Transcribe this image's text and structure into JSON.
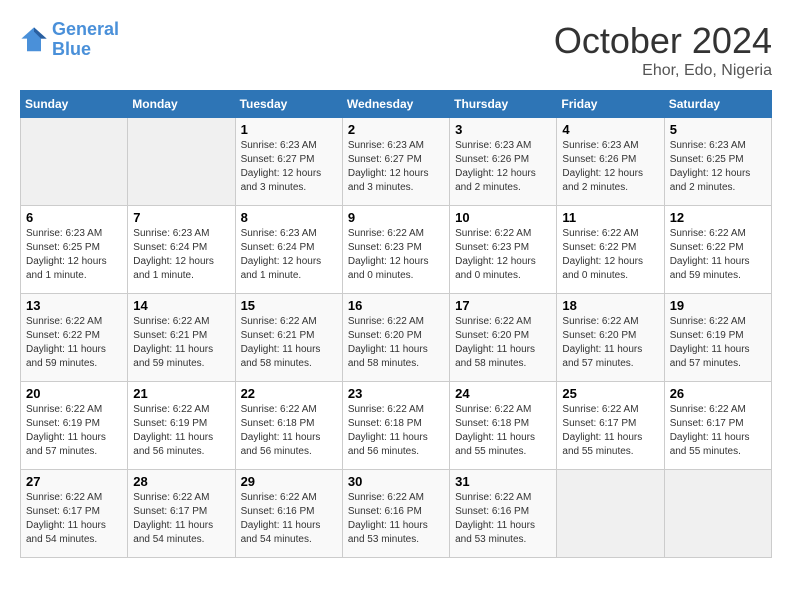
{
  "header": {
    "logo_line1": "General",
    "logo_line2": "Blue",
    "month": "October 2024",
    "location": "Ehor, Edo, Nigeria"
  },
  "weekdays": [
    "Sunday",
    "Monday",
    "Tuesday",
    "Wednesday",
    "Thursday",
    "Friday",
    "Saturday"
  ],
  "weeks": [
    [
      {
        "day": "",
        "sunrise": "",
        "sunset": "",
        "daylight": ""
      },
      {
        "day": "",
        "sunrise": "",
        "sunset": "",
        "daylight": ""
      },
      {
        "day": "1",
        "sunrise": "Sunrise: 6:23 AM",
        "sunset": "Sunset: 6:27 PM",
        "daylight": "Daylight: 12 hours and 3 minutes."
      },
      {
        "day": "2",
        "sunrise": "Sunrise: 6:23 AM",
        "sunset": "Sunset: 6:27 PM",
        "daylight": "Daylight: 12 hours and 3 minutes."
      },
      {
        "day": "3",
        "sunrise": "Sunrise: 6:23 AM",
        "sunset": "Sunset: 6:26 PM",
        "daylight": "Daylight: 12 hours and 2 minutes."
      },
      {
        "day": "4",
        "sunrise": "Sunrise: 6:23 AM",
        "sunset": "Sunset: 6:26 PM",
        "daylight": "Daylight: 12 hours and 2 minutes."
      },
      {
        "day": "5",
        "sunrise": "Sunrise: 6:23 AM",
        "sunset": "Sunset: 6:25 PM",
        "daylight": "Daylight: 12 hours and 2 minutes."
      }
    ],
    [
      {
        "day": "6",
        "sunrise": "Sunrise: 6:23 AM",
        "sunset": "Sunset: 6:25 PM",
        "daylight": "Daylight: 12 hours and 1 minute."
      },
      {
        "day": "7",
        "sunrise": "Sunrise: 6:23 AM",
        "sunset": "Sunset: 6:24 PM",
        "daylight": "Daylight: 12 hours and 1 minute."
      },
      {
        "day": "8",
        "sunrise": "Sunrise: 6:23 AM",
        "sunset": "Sunset: 6:24 PM",
        "daylight": "Daylight: 12 hours and 1 minute."
      },
      {
        "day": "9",
        "sunrise": "Sunrise: 6:22 AM",
        "sunset": "Sunset: 6:23 PM",
        "daylight": "Daylight: 12 hours and 0 minutes."
      },
      {
        "day": "10",
        "sunrise": "Sunrise: 6:22 AM",
        "sunset": "Sunset: 6:23 PM",
        "daylight": "Daylight: 12 hours and 0 minutes."
      },
      {
        "day": "11",
        "sunrise": "Sunrise: 6:22 AM",
        "sunset": "Sunset: 6:22 PM",
        "daylight": "Daylight: 12 hours and 0 minutes."
      },
      {
        "day": "12",
        "sunrise": "Sunrise: 6:22 AM",
        "sunset": "Sunset: 6:22 PM",
        "daylight": "Daylight: 11 hours and 59 minutes."
      }
    ],
    [
      {
        "day": "13",
        "sunrise": "Sunrise: 6:22 AM",
        "sunset": "Sunset: 6:22 PM",
        "daylight": "Daylight: 11 hours and 59 minutes."
      },
      {
        "day": "14",
        "sunrise": "Sunrise: 6:22 AM",
        "sunset": "Sunset: 6:21 PM",
        "daylight": "Daylight: 11 hours and 59 minutes."
      },
      {
        "day": "15",
        "sunrise": "Sunrise: 6:22 AM",
        "sunset": "Sunset: 6:21 PM",
        "daylight": "Daylight: 11 hours and 58 minutes."
      },
      {
        "day": "16",
        "sunrise": "Sunrise: 6:22 AM",
        "sunset": "Sunset: 6:20 PM",
        "daylight": "Daylight: 11 hours and 58 minutes."
      },
      {
        "day": "17",
        "sunrise": "Sunrise: 6:22 AM",
        "sunset": "Sunset: 6:20 PM",
        "daylight": "Daylight: 11 hours and 58 minutes."
      },
      {
        "day": "18",
        "sunrise": "Sunrise: 6:22 AM",
        "sunset": "Sunset: 6:20 PM",
        "daylight": "Daylight: 11 hours and 57 minutes."
      },
      {
        "day": "19",
        "sunrise": "Sunrise: 6:22 AM",
        "sunset": "Sunset: 6:19 PM",
        "daylight": "Daylight: 11 hours and 57 minutes."
      }
    ],
    [
      {
        "day": "20",
        "sunrise": "Sunrise: 6:22 AM",
        "sunset": "Sunset: 6:19 PM",
        "daylight": "Daylight: 11 hours and 57 minutes."
      },
      {
        "day": "21",
        "sunrise": "Sunrise: 6:22 AM",
        "sunset": "Sunset: 6:19 PM",
        "daylight": "Daylight: 11 hours and 56 minutes."
      },
      {
        "day": "22",
        "sunrise": "Sunrise: 6:22 AM",
        "sunset": "Sunset: 6:18 PM",
        "daylight": "Daylight: 11 hours and 56 minutes."
      },
      {
        "day": "23",
        "sunrise": "Sunrise: 6:22 AM",
        "sunset": "Sunset: 6:18 PM",
        "daylight": "Daylight: 11 hours and 56 minutes."
      },
      {
        "day": "24",
        "sunrise": "Sunrise: 6:22 AM",
        "sunset": "Sunset: 6:18 PM",
        "daylight": "Daylight: 11 hours and 55 minutes."
      },
      {
        "day": "25",
        "sunrise": "Sunrise: 6:22 AM",
        "sunset": "Sunset: 6:17 PM",
        "daylight": "Daylight: 11 hours and 55 minutes."
      },
      {
        "day": "26",
        "sunrise": "Sunrise: 6:22 AM",
        "sunset": "Sunset: 6:17 PM",
        "daylight": "Daylight: 11 hours and 55 minutes."
      }
    ],
    [
      {
        "day": "27",
        "sunrise": "Sunrise: 6:22 AM",
        "sunset": "Sunset: 6:17 PM",
        "daylight": "Daylight: 11 hours and 54 minutes."
      },
      {
        "day": "28",
        "sunrise": "Sunrise: 6:22 AM",
        "sunset": "Sunset: 6:17 PM",
        "daylight": "Daylight: 11 hours and 54 minutes."
      },
      {
        "day": "29",
        "sunrise": "Sunrise: 6:22 AM",
        "sunset": "Sunset: 6:16 PM",
        "daylight": "Daylight: 11 hours and 54 minutes."
      },
      {
        "day": "30",
        "sunrise": "Sunrise: 6:22 AM",
        "sunset": "Sunset: 6:16 PM",
        "daylight": "Daylight: 11 hours and 53 minutes."
      },
      {
        "day": "31",
        "sunrise": "Sunrise: 6:22 AM",
        "sunset": "Sunset: 6:16 PM",
        "daylight": "Daylight: 11 hours and 53 minutes."
      },
      {
        "day": "",
        "sunrise": "",
        "sunset": "",
        "daylight": ""
      },
      {
        "day": "",
        "sunrise": "",
        "sunset": "",
        "daylight": ""
      }
    ]
  ]
}
